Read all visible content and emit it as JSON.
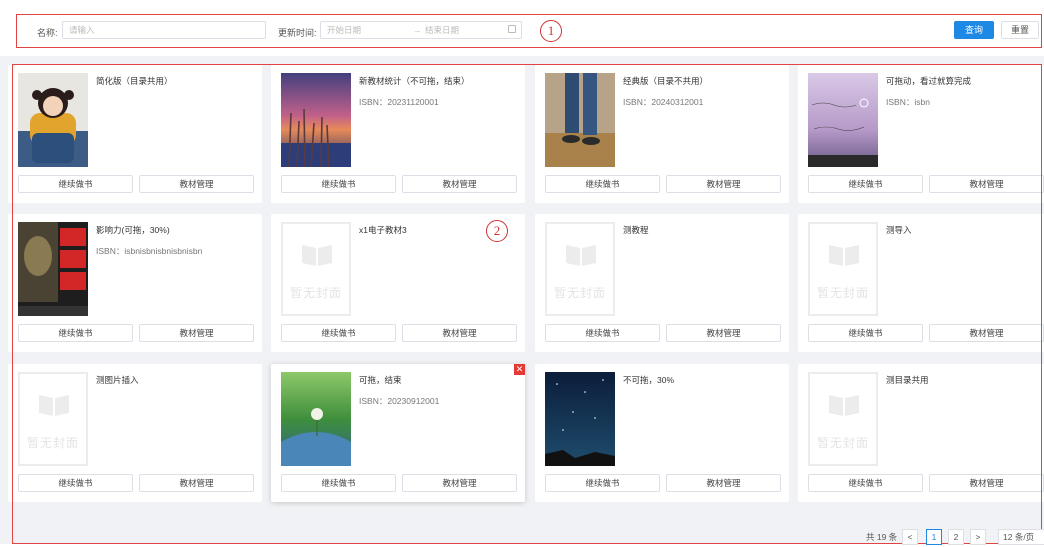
{
  "filters": {
    "name_label": "名称:",
    "name_placeholder": "请输入",
    "time_label": "更新时间:",
    "start_placeholder": "开始日期",
    "range_sep": "→",
    "end_placeholder": "结束日期",
    "calendar_icon": "calendar-icon",
    "search_button": "查询",
    "reset_button": "重置"
  },
  "annotations": {
    "one": "1",
    "two": "2"
  },
  "colors": {
    "primary": "#1e88e5",
    "annotation": "#e24444",
    "delete": "#e53935"
  },
  "card_buttons": {
    "continue": "继续做书",
    "manage": "教材管理"
  },
  "placeholder_cover_text": "暂无封面",
  "cards": [
    {
      "title": "简化版（目录共用）",
      "isbn": ""
    },
    {
      "title": "新教材统计（不可拖，结束）",
      "isbn": "ISBN：20231120001"
    },
    {
      "title": "经典版（目录不共用）",
      "isbn": "ISBN：20240312001"
    },
    {
      "title": "可拖动，看过就算完成",
      "isbn": "ISBN：isbn"
    },
    {
      "title": "影响力(可拖，30%)",
      "isbn": "ISBN：isbnisbnisbnisbnisbn"
    },
    {
      "title": "x1电子教材3",
      "isbn": ""
    },
    {
      "title": "测教程",
      "isbn": ""
    },
    {
      "title": "测导入",
      "isbn": ""
    },
    {
      "title": "测图片插入",
      "isbn": ""
    },
    {
      "title": "可拖，结束",
      "isbn": "ISBN：20230912001"
    },
    {
      "title": "不可拖，30%",
      "isbn": ""
    },
    {
      "title": "测目录共用",
      "isbn": ""
    }
  ],
  "pagination": {
    "total": "共 19 条",
    "prev": "<",
    "page1": "1",
    "page2": "2",
    "next": ">",
    "page_size": "12 条/页"
  }
}
